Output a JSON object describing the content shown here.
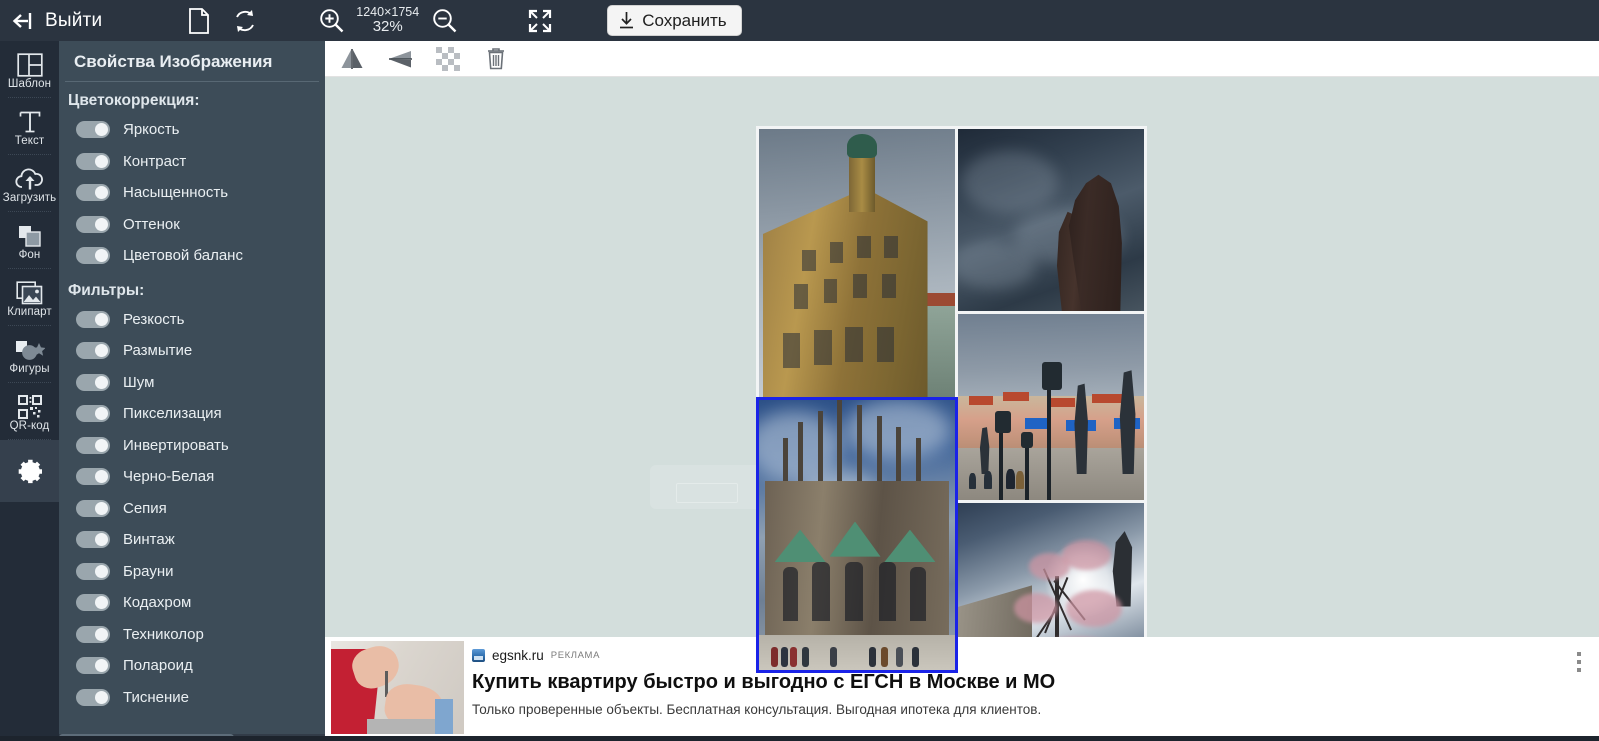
{
  "topbar": {
    "exit_label": "Выйти",
    "exit_icon": "exit-arrow-icon",
    "new_doc_icon": "new-document-icon",
    "reload_icon": "reload-icon",
    "zoom_in_icon": "zoom-in-icon",
    "zoom_out_icon": "zoom-out-icon",
    "fullscreen_icon": "fullscreen-icon",
    "image_dimensions": "1240×1754",
    "zoom_level": "32%",
    "save_label": "Сохранить",
    "save_icon": "download-icon",
    "bg_color": "#2b3440"
  },
  "rail": {
    "items": [
      {
        "label": "Шаблон",
        "icon": "template-icon"
      },
      {
        "label": "Текст",
        "icon": "text-icon"
      },
      {
        "label": "Загрузить",
        "icon": "upload-cloud-icon"
      },
      {
        "label": "Фон",
        "icon": "background-icon"
      },
      {
        "label": "Клипарт",
        "icon": "clipart-icon"
      },
      {
        "label": "Фигуры",
        "icon": "shapes-icon"
      },
      {
        "label": "QR-код",
        "icon": "qr-code-icon"
      }
    ],
    "settings_icon": "gear-icon",
    "bg_color": "#232c38",
    "active_bg_color": "#35404d"
  },
  "panel": {
    "title": "Свойства Изображения",
    "bg_color": "#3d4c58",
    "groups": [
      {
        "heading": "Цветокоррекция:",
        "options": [
          {
            "label": "Яркость",
            "enabled": false
          },
          {
            "label": "Контраст",
            "enabled": false
          },
          {
            "label": "Насыщенность",
            "enabled": false
          },
          {
            "label": "Оттенок",
            "enabled": false
          },
          {
            "label": "Цветовой баланс",
            "enabled": false
          }
        ]
      },
      {
        "heading": "Фильтры:",
        "options": [
          {
            "label": "Резкость",
            "enabled": false
          },
          {
            "label": "Размытие",
            "enabled": false
          },
          {
            "label": "Шум",
            "enabled": false
          },
          {
            "label": "Пикселизация",
            "enabled": false
          },
          {
            "label": "Инвертировать",
            "enabled": false
          },
          {
            "label": "Черно-Белая",
            "enabled": false
          },
          {
            "label": "Сепия",
            "enabled": false
          },
          {
            "label": "Винтаж",
            "enabled": false
          },
          {
            "label": "Брауни",
            "enabled": false
          },
          {
            "label": "Кодахром",
            "enabled": false
          },
          {
            "label": "Техниколор",
            "enabled": false
          },
          {
            "label": "Полароид",
            "enabled": false
          },
          {
            "label": "Тиснение",
            "enabled": false
          }
        ]
      }
    ]
  },
  "edit_toolbar": {
    "buttons": [
      {
        "icon": "flip-horizontal-icon"
      },
      {
        "icon": "flip-vertical-icon"
      },
      {
        "icon": "transparency-checker-icon"
      },
      {
        "icon": "trash-icon"
      }
    ],
    "bg_color": "#ffffff"
  },
  "canvas": {
    "bg_color": "#d3dedc",
    "selection_color": "#1a23e8",
    "collage": {
      "tiles": [
        {
          "name": "ornate-building-photo",
          "selected": false
        },
        {
          "name": "statue-silhouette-photo",
          "selected": false
        },
        {
          "name": "charles-bridge-photo",
          "selected": false
        },
        {
          "name": "cathedral-photo",
          "selected": true
        },
        {
          "name": "blossom-tree-photo",
          "selected": false
        }
      ]
    }
  },
  "ad": {
    "domain": "egsnk.ru",
    "flag": "РЕКЛАМА",
    "title": "Купить квартиру быстро и выгодно с ЕГСН в Москве и МО",
    "description": "Только проверенные объекты. Бесплатная консультация. Выгодная ипотека для клиентов.",
    "menu_icon": "more-vertical-icon",
    "image_alt": "hand-with-keys-photo"
  }
}
